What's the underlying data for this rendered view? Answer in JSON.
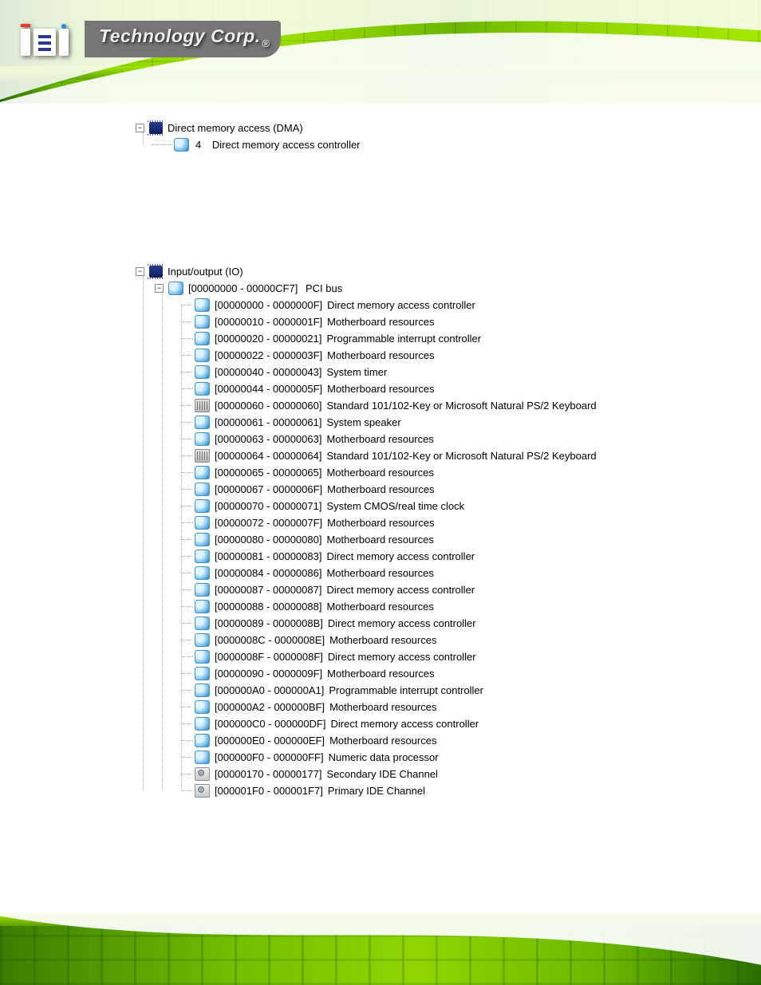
{
  "brand": {
    "logo_alt": "iEi",
    "tagline": "Technology Corp."
  },
  "dma": {
    "title": "Direct memory access (DMA)",
    "channel_number": "4",
    "channel_label": "Direct memory access controller"
  },
  "io": {
    "title": "Input/output (IO)",
    "bus": {
      "range": "[00000000 - 00000CF7]",
      "label": "PCI bus"
    },
    "items": [
      {
        "range": "[00000000 - 0000000F]",
        "label": "Direct memory access controller",
        "icon": "device"
      },
      {
        "range": "[00000010 - 0000001F]",
        "label": "Motherboard resources",
        "icon": "device"
      },
      {
        "range": "[00000020 - 00000021]",
        "label": "Programmable interrupt controller",
        "icon": "device"
      },
      {
        "range": "[00000022 - 0000003F]",
        "label": "Motherboard resources",
        "icon": "device"
      },
      {
        "range": "[00000040 - 00000043]",
        "label": "System timer",
        "icon": "device"
      },
      {
        "range": "[00000044 - 0000005F]",
        "label": "Motherboard resources",
        "icon": "device"
      },
      {
        "range": "[00000060 - 00000060]",
        "label": "Standard 101/102-Key or Microsoft Natural PS/2 Keyboard",
        "icon": "kbd"
      },
      {
        "range": "[00000061 - 00000061]",
        "label": "System speaker",
        "icon": "device"
      },
      {
        "range": "[00000063 - 00000063]",
        "label": "Motherboard resources",
        "icon": "device"
      },
      {
        "range": "[00000064 - 00000064]",
        "label": "Standard 101/102-Key or Microsoft Natural PS/2 Keyboard",
        "icon": "kbd"
      },
      {
        "range": "[00000065 - 00000065]",
        "label": "Motherboard resources",
        "icon": "device"
      },
      {
        "range": "[00000067 - 0000006F]",
        "label": "Motherboard resources",
        "icon": "device"
      },
      {
        "range": "[00000070 - 00000071]",
        "label": "System CMOS/real time clock",
        "icon": "device"
      },
      {
        "range": "[00000072 - 0000007F]",
        "label": "Motherboard resources",
        "icon": "device"
      },
      {
        "range": "[00000080 - 00000080]",
        "label": "Motherboard resources",
        "icon": "device"
      },
      {
        "range": "[00000081 - 00000083]",
        "label": "Direct memory access controller",
        "icon": "device"
      },
      {
        "range": "[00000084 - 00000086]",
        "label": "Motherboard resources",
        "icon": "device"
      },
      {
        "range": "[00000087 - 00000087]",
        "label": "Direct memory access controller",
        "icon": "device"
      },
      {
        "range": "[00000088 - 00000088]",
        "label": "Motherboard resources",
        "icon": "device"
      },
      {
        "range": "[00000089 - 0000008B]",
        "label": "Direct memory access controller",
        "icon": "device"
      },
      {
        "range": "[0000008C - 0000008E]",
        "label": "Motherboard resources",
        "icon": "device"
      },
      {
        "range": "[0000008F - 0000008F]",
        "label": "Direct memory access controller",
        "icon": "device"
      },
      {
        "range": "[00000090 - 0000009F]",
        "label": "Motherboard resources",
        "icon": "device"
      },
      {
        "range": "[000000A0 - 000000A1]",
        "label": "Programmable interrupt controller",
        "icon": "device"
      },
      {
        "range": "[000000A2 - 000000BF]",
        "label": "Motherboard resources",
        "icon": "device"
      },
      {
        "range": "[000000C0 - 000000DF]",
        "label": "Direct memory access controller",
        "icon": "device"
      },
      {
        "range": "[000000E0 - 000000EF]",
        "label": "Motherboard resources",
        "icon": "device"
      },
      {
        "range": "[000000F0 - 000000FF]",
        "label": "Numeric data processor",
        "icon": "device"
      },
      {
        "range": "[00000170 - 00000177]",
        "label": "Secondary IDE Channel",
        "icon": "disk"
      },
      {
        "range": "[000001F0 - 000001F7]",
        "label": "Primary IDE Channel",
        "icon": "disk"
      }
    ]
  }
}
